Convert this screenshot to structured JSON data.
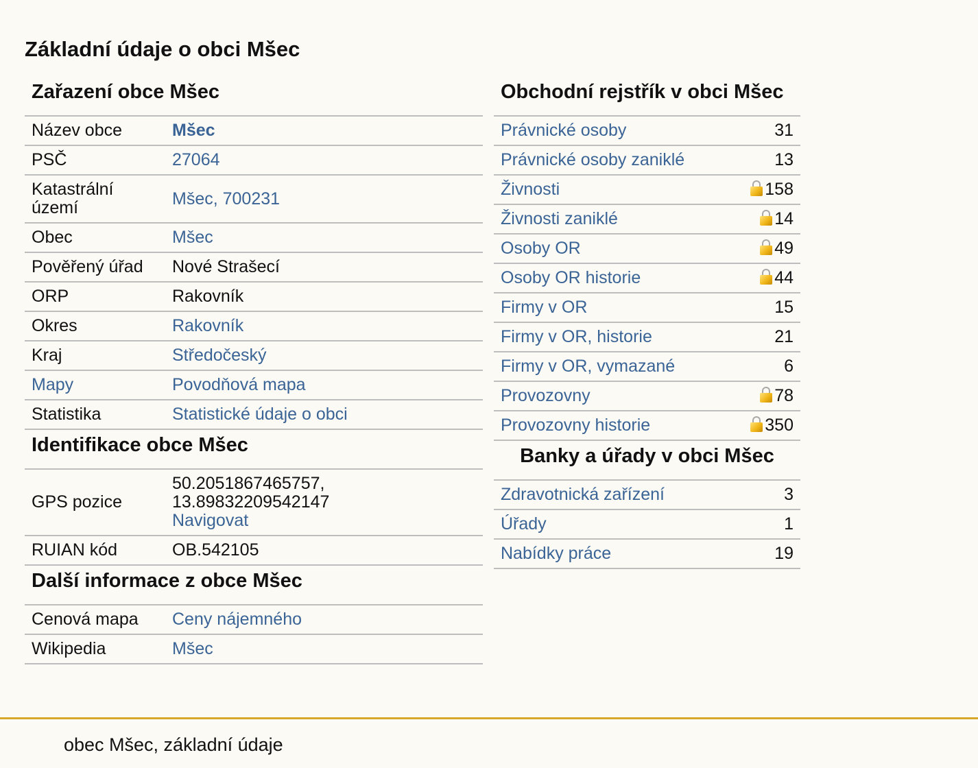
{
  "page_title": "Základní údaje o obci Mšec",
  "zarazeni": {
    "title": "Zařazení obce Mšec",
    "rows": [
      {
        "label": "Název obce",
        "value": "Mšec"
      },
      {
        "label": "PSČ",
        "value": "27064"
      },
      {
        "label": "Katastrální území",
        "value": "Mšec, 700231"
      },
      {
        "label": "Obec",
        "value": "Mšec"
      },
      {
        "label": "Pověřený úřad",
        "value": "Nové Strašecí"
      },
      {
        "label": "ORP",
        "value": "Rakovník"
      },
      {
        "label": "Okres",
        "value": "Rakovník"
      },
      {
        "label": "Kraj",
        "value": "Středočeský"
      },
      {
        "label": "Mapy",
        "value": "Povodňová mapa"
      },
      {
        "label": "Statistika",
        "value": "Statistické údaje o obci"
      }
    ]
  },
  "identifikace": {
    "title": "Identifikace obce Mšec",
    "gps_label": "GPS pozice",
    "gps_lat": "50.2051867465757,",
    "gps_lon": "13.89832209542147",
    "gps_link": "Navigovat",
    "ruian_label": "RUIAN kód",
    "ruian_value": "OB.542105"
  },
  "dalsi": {
    "title": "Další informace z obce Mšec",
    "rows": [
      {
        "label": "Cenová mapa",
        "value": "Ceny nájemného"
      },
      {
        "label": "Wikipedia",
        "value": "Mšec"
      }
    ]
  },
  "obchodni": {
    "title": "Obchodní rejstřík v obci Mšec",
    "rows": [
      {
        "label": "Právnické osoby",
        "value": "31",
        "icon": null
      },
      {
        "label": "Právnické osoby zaniklé",
        "value": "13",
        "icon": null
      },
      {
        "label": "Živnosti",
        "value": "158",
        "icon": "lock-icon"
      },
      {
        "label": "Živnosti zaniklé",
        "value": "14",
        "icon": "lock-icon"
      },
      {
        "label": "Osoby OR",
        "value": "49",
        "icon": "lock-icon"
      },
      {
        "label": "Osoby OR historie",
        "value": "44",
        "icon": "lock-icon"
      },
      {
        "label": "Firmy v OR",
        "value": "15",
        "icon": null
      },
      {
        "label": "Firmy v OR, historie",
        "value": "21",
        "icon": null
      },
      {
        "label": "Firmy v OR, vymazané",
        "value": "6",
        "icon": null
      },
      {
        "label": "Provozovny",
        "value": "78",
        "icon": "lock-icon"
      },
      {
        "label": "Provozovny historie",
        "value": "350",
        "icon": "lock-icon"
      }
    ]
  },
  "banky": {
    "title": "Banky a úřady v obci Mšec",
    "rows": [
      {
        "label": "Zdravotnická zařízení",
        "value": "3"
      },
      {
        "label": "Úřady",
        "value": "1"
      },
      {
        "label": "Nabídky práce",
        "value": "19"
      }
    ]
  },
  "footer": {
    "text": "obec Mšec, základní údaje"
  }
}
